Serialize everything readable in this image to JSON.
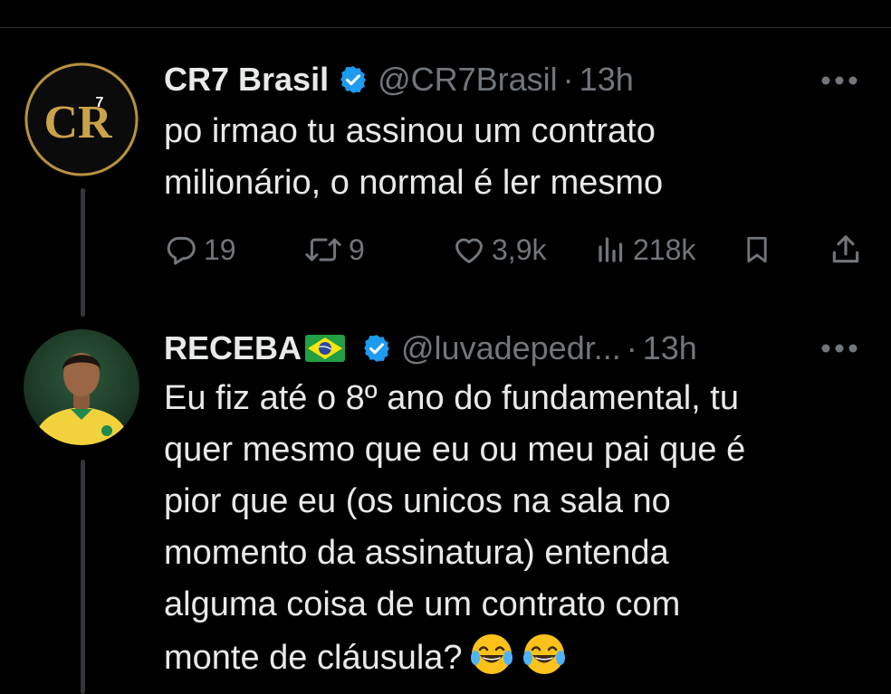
{
  "tweets": [
    {
      "display_name": "CR7 Brasil",
      "handle": "@CR7Brasil",
      "separator": "·",
      "time": "13h",
      "text": "po irmao tu assinou um contrato\nmilionário, o normal é ler mesmo",
      "avatar_text": "CR",
      "avatar_superscript": "7",
      "actions": {
        "replies": "19",
        "retweets": "9",
        "likes": "3,9k",
        "views": "218k"
      }
    },
    {
      "display_name": "RECEBA",
      "handle": "@luvadepedr...",
      "separator": "·",
      "time": "13h",
      "text": "Eu fiz até o 8º ano do fundamental, tu\nquer mesmo que eu ou meu pai que é\npior que eu (os unicos na sala no\nmomento da assinatura) entenda\nalguma coisa de um contrato com\nmonte de cláusula?"
    }
  ],
  "colors": {
    "background": "#000000",
    "text_primary": "#e7e9ea",
    "text_secondary": "#71767b",
    "verified_blue": "#1d9bf0",
    "brand_gold": "#c9a24a"
  },
  "icons": [
    "verified-badge-icon",
    "more-icon",
    "reply-icon",
    "retweet-icon",
    "like-icon",
    "views-icon",
    "bookmark-icon",
    "share-icon",
    "brazil-flag-icon",
    "laughing-emoji-icon"
  ]
}
